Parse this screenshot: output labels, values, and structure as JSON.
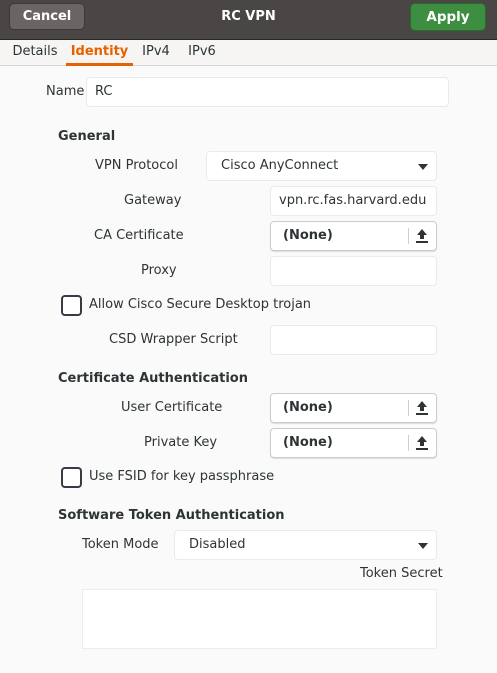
{
  "header": {
    "cancel_label": "Cancel",
    "title": "RC VPN",
    "apply_label": "Apply"
  },
  "tabs": [
    {
      "label": "Details",
      "active": false
    },
    {
      "label": "Identity",
      "active": true
    },
    {
      "label": "IPv4",
      "active": false
    },
    {
      "label": "IPv6",
      "active": false
    }
  ],
  "colors": {
    "accent": "#e66100",
    "apply": "#3e8e41",
    "header": "#4a4645"
  },
  "name": {
    "label": "Name",
    "value": "RC"
  },
  "general": {
    "title": "General",
    "vpn_protocol": {
      "label": "VPN Protocol",
      "value": "Cisco AnyConnect"
    },
    "gateway": {
      "label": "Gateway",
      "value": "vpn.rc.fas.harvard.edu"
    },
    "ca_certificate": {
      "label": "CA Certificate",
      "value": "(None)",
      "icon": "upload-icon"
    },
    "proxy": {
      "label": "Proxy",
      "value": ""
    },
    "csd_trojan": {
      "label": "Allow Cisco Secure Desktop trojan",
      "checked": false
    },
    "csd_wrapper": {
      "label": "CSD Wrapper Script",
      "value": ""
    }
  },
  "cert_auth": {
    "title": "Certificate Authentication",
    "user_certificate": {
      "label": "User Certificate",
      "value": "(None)",
      "icon": "upload-icon"
    },
    "private_key": {
      "label": "Private Key",
      "value": "(None)",
      "icon": "upload-icon"
    },
    "fsid": {
      "label": "Use FSID for key passphrase",
      "checked": false
    }
  },
  "token_auth": {
    "title": "Software Token Authentication",
    "token_mode": {
      "label": "Token Mode",
      "value": "Disabled"
    },
    "token_secret": {
      "label": "Token Secret",
      "value": ""
    }
  }
}
